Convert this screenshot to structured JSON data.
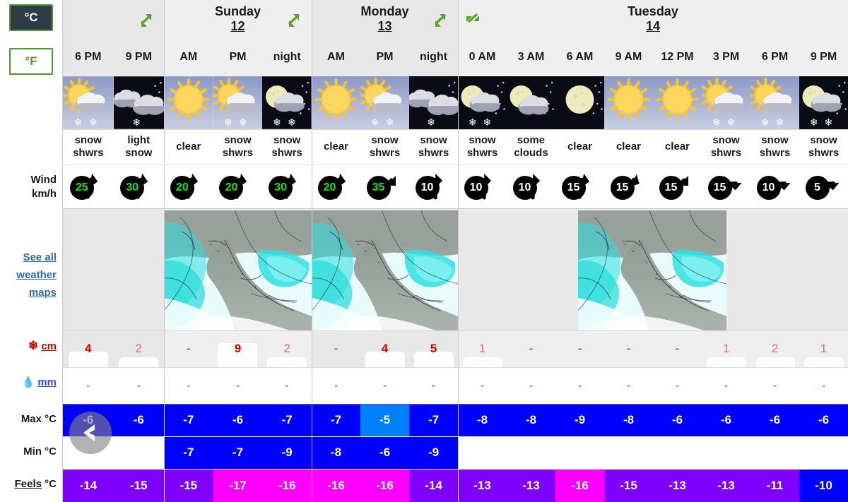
{
  "units": {
    "celsius": "°C",
    "fahrenheit": "°F",
    "selected": "°C"
  },
  "row_labels": {
    "wind": "Wind",
    "wind_unit": "km/h",
    "maps_link": "See all weather maps",
    "snow": "cm",
    "rain": "mm",
    "max": "Max °C",
    "min": "Min °C",
    "feels": "Feels",
    "feels_unit": "°C"
  },
  "days": [
    {
      "name": "",
      "date": "",
      "hours": [
        "6 PM",
        "9 PM"
      ]
    },
    {
      "name": "Sunday",
      "date": "12",
      "hours": [
        "AM",
        "PM",
        "night"
      ]
    },
    {
      "name": "Monday",
      "date": "13",
      "hours": [
        "AM",
        "PM",
        "night"
      ]
    },
    {
      "name": "Tuesday",
      "date": "14",
      "hours": [
        "0 AM",
        "3 AM",
        "6 AM",
        "9 AM",
        "12 PM",
        "3 PM",
        "6 PM",
        "9 PM"
      ]
    }
  ],
  "columns": [
    {
      "hour": "6 PM",
      "condition": "snow shwrs",
      "icon": "sun-cloud-snow",
      "period": "day",
      "wind": "25",
      "wind_dir": "ne",
      "snow": "4",
      "snow_level": "strong",
      "rain": "-",
      "max": "-6",
      "min": "",
      "feels": "-14",
      "max_color": "#0000FF",
      "feels_color": "#7F00FF"
    },
    {
      "hour": "9 PM",
      "condition": "light snow",
      "icon": "cloud-snow",
      "period": "night",
      "wind": "30",
      "wind_dir": "ne",
      "snow": "2",
      "snow_level": "light",
      "rain": "-",
      "max": "-6",
      "min": "",
      "feels": "-15",
      "max_color": "#0000FF",
      "feels_color": "#7F00FF"
    },
    {
      "hour": "AM",
      "condition": "clear",
      "icon": "sun",
      "period": "day",
      "wind": "20",
      "wind_dir": "ne",
      "snow": "-",
      "snow_level": "dash",
      "rain": "-",
      "max": "-7",
      "min": "-7",
      "feels": "-15",
      "max_color": "#0000FF",
      "feels_color": "#7F00FF"
    },
    {
      "hour": "PM",
      "condition": "snow shwrs",
      "icon": "sun-cloud-snow",
      "period": "day",
      "wind": "20",
      "wind_dir": "ne",
      "snow": "9",
      "snow_level": "strong",
      "rain": "-",
      "max": "-6",
      "min": "-7",
      "feels": "-17",
      "max_color": "#0000FF",
      "feels_color": "#FF00FF"
    },
    {
      "hour": "night",
      "condition": "snow shwrs",
      "icon": "moon-cloud-snow",
      "period": "night",
      "wind": "30",
      "wind_dir": "ne",
      "snow": "2",
      "snow_level": "light",
      "rain": "-",
      "max": "-7",
      "min": "-9",
      "feels": "-16",
      "max_color": "#0000FF",
      "feels_color": "#FF00FF"
    },
    {
      "hour": "AM",
      "condition": "clear",
      "icon": "sun",
      "period": "day",
      "wind": "20",
      "wind_dir": "ne",
      "snow": "-",
      "snow_level": "dash",
      "rain": "-",
      "max": "-7",
      "min": "-8",
      "feels": "-16",
      "max_color": "#0000FF",
      "feels_color": "#FF00FF"
    },
    {
      "hour": "PM",
      "condition": "snow shwrs",
      "icon": "sun-cloud-snow",
      "period": "day",
      "wind": "35",
      "wind_dir": "e",
      "snow": "4",
      "snow_level": "strong",
      "rain": "-",
      "max": "-5",
      "min": "-6",
      "feels": "-16",
      "max_color": "#0080FF",
      "feels_color": "#FF00FF"
    },
    {
      "hour": "night",
      "condition": "snow shwrs",
      "icon": "cloud-snow",
      "period": "night",
      "wind": "10",
      "wind_dir": "n",
      "snow": "5",
      "snow_level": "strong",
      "rain": "-",
      "max": "-7",
      "min": "-9",
      "feels": "-14",
      "max_color": "#0000FF",
      "feels_color": "#7F00FF"
    },
    {
      "hour": "0 AM",
      "condition": "snow shwrs",
      "icon": "moon-cloud-snow",
      "period": "night",
      "wind": "10",
      "wind_dir": "n",
      "snow": "1",
      "snow_level": "light",
      "rain": "-",
      "max": "-8",
      "min": "",
      "feels": "-13",
      "max_color": "#0000FF",
      "feels_color": "#7F00FF"
    },
    {
      "hour": "3 AM",
      "condition": "some clouds",
      "icon": "moon-cloud",
      "period": "night",
      "wind": "10",
      "wind_dir": "n",
      "snow": "-",
      "snow_level": "dash",
      "rain": "-",
      "max": "-8",
      "min": "",
      "feels": "-13",
      "max_color": "#0000FF",
      "feels_color": "#7F00FF"
    },
    {
      "hour": "6 AM",
      "condition": "clear",
      "icon": "moon",
      "period": "night",
      "wind": "15",
      "wind_dir": "ne",
      "snow": "-",
      "snow_level": "dash",
      "rain": "-",
      "max": "-9",
      "min": "",
      "feels": "-16",
      "max_color": "#0000FF",
      "feels_color": "#FF00FF"
    },
    {
      "hour": "9 AM",
      "condition": "clear",
      "icon": "sun",
      "period": "day",
      "wind": "15",
      "wind_dir": "ene",
      "snow": "-",
      "snow_level": "dash",
      "rain": "-",
      "max": "-8",
      "min": "",
      "feels": "-15",
      "max_color": "#0000FF",
      "feels_color": "#7F00FF"
    },
    {
      "hour": "12 PM",
      "condition": "clear",
      "icon": "sun",
      "period": "day",
      "wind": "15",
      "wind_dir": "e",
      "snow": "-",
      "snow_level": "dash",
      "rain": "-",
      "max": "-6",
      "min": "",
      "feels": "-13",
      "max_color": "#0000FF",
      "feels_color": "#7F00FF"
    },
    {
      "hour": "3 PM",
      "condition": "snow shwrs",
      "icon": "sun-cloud-snow",
      "period": "day",
      "wind": "15",
      "wind_dir": "se",
      "snow": "1",
      "snow_level": "light",
      "rain": "-",
      "max": "-6",
      "min": "",
      "feels": "-13",
      "max_color": "#0000FF",
      "feels_color": "#7F00FF"
    },
    {
      "hour": "6 PM",
      "condition": "snow shwrs",
      "icon": "sun-cloud-snow",
      "period": "day",
      "wind": "10",
      "wind_dir": "se",
      "snow": "2",
      "snow_level": "light",
      "rain": "-",
      "max": "-6",
      "min": "",
      "feels": "-11",
      "max_color": "#0000FF",
      "feels_color": "#7F00FF"
    },
    {
      "hour": "9 PM",
      "condition": "snow shwrs",
      "icon": "moon-cloud-snow",
      "period": "night",
      "wind": "5",
      "wind_dir": "se",
      "snow": "1",
      "snow_level": "light",
      "rain": "-",
      "max": "-6",
      "min": "",
      "feels": "-10",
      "max_color": "#0000FF",
      "feels_color": "#0000FF"
    }
  ],
  "colors": {
    "accent_green": "#4f9a2a",
    "temp_blue": "#0000FF",
    "temp_light_blue": "#0080FF",
    "feels_purple": "#7F00FF",
    "feels_magenta": "#FF00FF",
    "snow_red": "#cf0000",
    "rain_blue": "#2a4fd8"
  },
  "icons": {
    "expand": "expand-arrows-icon",
    "collapse": "collapse-arrows-icon",
    "snowflake": "snowflake-icon",
    "raindrop": "raindrop-icon",
    "prev": "previous-chevron-icon"
  }
}
